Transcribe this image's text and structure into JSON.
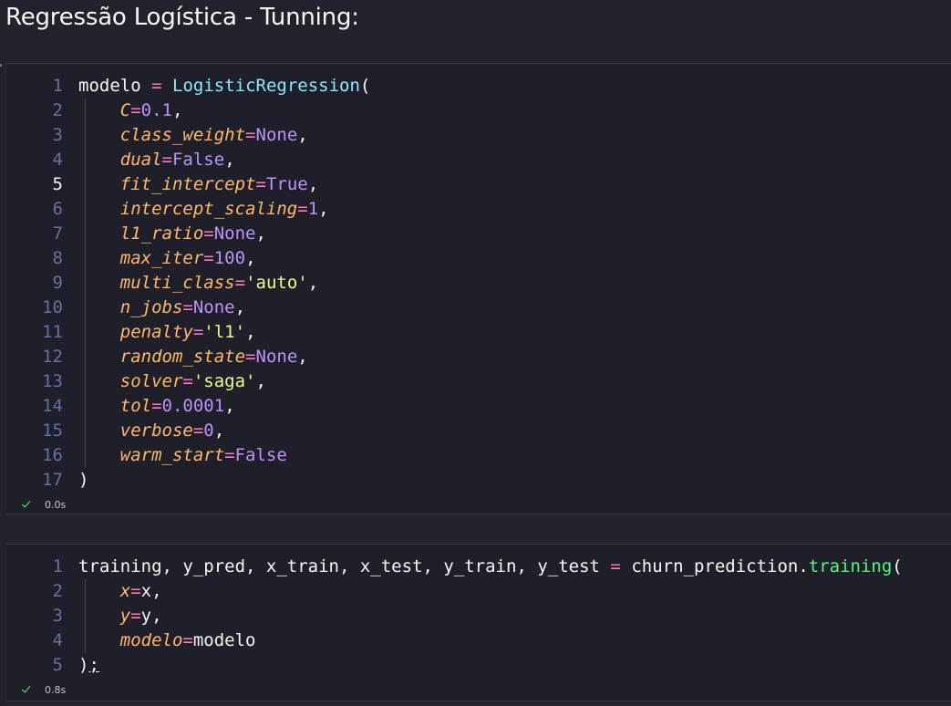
{
  "markdown": {
    "title": "Regressão Logística - Tunning:"
  },
  "cells": [
    {
      "status_time": "0.0s",
      "active_line": 5,
      "lines": [
        {
          "n": "1",
          "indent": false,
          "tokens": [
            {
              "t": "modelo",
              "c": "default"
            },
            {
              "t": " ",
              "c": "default"
            },
            {
              "t": "=",
              "c": "op"
            },
            {
              "t": " ",
              "c": "default"
            },
            {
              "t": "LogisticRegression",
              "c": "cls"
            },
            {
              "t": "(",
              "c": "punct"
            }
          ]
        },
        {
          "n": "2",
          "indent": true,
          "tokens": [
            {
              "t": "    ",
              "c": "default"
            },
            {
              "t": "C",
              "c": "param"
            },
            {
              "t": "=",
              "c": "op"
            },
            {
              "t": "0.1",
              "c": "num"
            },
            {
              "t": ",",
              "c": "punct"
            }
          ]
        },
        {
          "n": "3",
          "indent": true,
          "tokens": [
            {
              "t": "    ",
              "c": "default"
            },
            {
              "t": "class_weight",
              "c": "param"
            },
            {
              "t": "=",
              "c": "op"
            },
            {
              "t": "None",
              "c": "const"
            },
            {
              "t": ",",
              "c": "punct"
            }
          ]
        },
        {
          "n": "4",
          "indent": true,
          "tokens": [
            {
              "t": "    ",
              "c": "default"
            },
            {
              "t": "dual",
              "c": "param"
            },
            {
              "t": "=",
              "c": "op"
            },
            {
              "t": "False",
              "c": "const"
            },
            {
              "t": ",",
              "c": "punct"
            }
          ]
        },
        {
          "n": "5",
          "indent": true,
          "tokens": [
            {
              "t": "    ",
              "c": "default"
            },
            {
              "t": "fit_intercept",
              "c": "param"
            },
            {
              "t": "=",
              "c": "op"
            },
            {
              "t": "True",
              "c": "const"
            },
            {
              "t": ",",
              "c": "punct"
            }
          ]
        },
        {
          "n": "6",
          "indent": true,
          "tokens": [
            {
              "t": "    ",
              "c": "default"
            },
            {
              "t": "intercept_scaling",
              "c": "param"
            },
            {
              "t": "=",
              "c": "op"
            },
            {
              "t": "1",
              "c": "num"
            },
            {
              "t": ",",
              "c": "punct"
            }
          ]
        },
        {
          "n": "7",
          "indent": true,
          "tokens": [
            {
              "t": "    ",
              "c": "default"
            },
            {
              "t": "l1_ratio",
              "c": "param"
            },
            {
              "t": "=",
              "c": "op"
            },
            {
              "t": "None",
              "c": "const"
            },
            {
              "t": ",",
              "c": "punct"
            }
          ]
        },
        {
          "n": "8",
          "indent": true,
          "tokens": [
            {
              "t": "    ",
              "c": "default"
            },
            {
              "t": "max_iter",
              "c": "param"
            },
            {
              "t": "=",
              "c": "op"
            },
            {
              "t": "100",
              "c": "num"
            },
            {
              "t": ",",
              "c": "punct"
            }
          ]
        },
        {
          "n": "9",
          "indent": true,
          "tokens": [
            {
              "t": "    ",
              "c": "default"
            },
            {
              "t": "multi_class",
              "c": "param"
            },
            {
              "t": "=",
              "c": "op"
            },
            {
              "t": "'auto'",
              "c": "str"
            },
            {
              "t": ",",
              "c": "punct"
            }
          ]
        },
        {
          "n": "10",
          "indent": true,
          "tokens": [
            {
              "t": "    ",
              "c": "default"
            },
            {
              "t": "n_jobs",
              "c": "param"
            },
            {
              "t": "=",
              "c": "op"
            },
            {
              "t": "None",
              "c": "const"
            },
            {
              "t": ",",
              "c": "punct"
            }
          ]
        },
        {
          "n": "11",
          "indent": true,
          "tokens": [
            {
              "t": "    ",
              "c": "default"
            },
            {
              "t": "penalty",
              "c": "param"
            },
            {
              "t": "=",
              "c": "op"
            },
            {
              "t": "'l1'",
              "c": "str"
            },
            {
              "t": ",",
              "c": "punct"
            }
          ]
        },
        {
          "n": "12",
          "indent": true,
          "tokens": [
            {
              "t": "    ",
              "c": "default"
            },
            {
              "t": "random_state",
              "c": "param"
            },
            {
              "t": "=",
              "c": "op"
            },
            {
              "t": "None",
              "c": "const"
            },
            {
              "t": ",",
              "c": "punct"
            }
          ]
        },
        {
          "n": "13",
          "indent": true,
          "tokens": [
            {
              "t": "    ",
              "c": "default"
            },
            {
              "t": "solver",
              "c": "param"
            },
            {
              "t": "=",
              "c": "op"
            },
            {
              "t": "'saga'",
              "c": "str"
            },
            {
              "t": ",",
              "c": "punct"
            }
          ]
        },
        {
          "n": "14",
          "indent": true,
          "tokens": [
            {
              "t": "    ",
              "c": "default"
            },
            {
              "t": "tol",
              "c": "param"
            },
            {
              "t": "=",
              "c": "op"
            },
            {
              "t": "0.0001",
              "c": "num"
            },
            {
              "t": ",",
              "c": "punct"
            }
          ]
        },
        {
          "n": "15",
          "indent": true,
          "tokens": [
            {
              "t": "    ",
              "c": "default"
            },
            {
              "t": "verbose",
              "c": "param"
            },
            {
              "t": "=",
              "c": "op"
            },
            {
              "t": "0",
              "c": "num"
            },
            {
              "t": ",",
              "c": "punct"
            }
          ]
        },
        {
          "n": "16",
          "indent": true,
          "tokens": [
            {
              "t": "    ",
              "c": "default"
            },
            {
              "t": "warm_start",
              "c": "param"
            },
            {
              "t": "=",
              "c": "op"
            },
            {
              "t": "False",
              "c": "const"
            }
          ]
        },
        {
          "n": "17",
          "indent": false,
          "tokens": [
            {
              "t": ")",
              "c": "punct"
            }
          ]
        }
      ]
    },
    {
      "status_time": "0.8s",
      "active_line": 0,
      "lines": [
        {
          "n": "1",
          "indent": false,
          "tokens": [
            {
              "t": "training, y_pred, x_train, x_test, y_train, y_test",
              "c": "default"
            },
            {
              "t": " ",
              "c": "default"
            },
            {
              "t": "=",
              "c": "op"
            },
            {
              "t": " ",
              "c": "default"
            },
            {
              "t": "churn_prediction.",
              "c": "default"
            },
            {
              "t": "training",
              "c": "fn"
            },
            {
              "t": "(",
              "c": "punct"
            }
          ]
        },
        {
          "n": "2",
          "indent": true,
          "tokens": [
            {
              "t": "    ",
              "c": "default"
            },
            {
              "t": "x",
              "c": "param"
            },
            {
              "t": "=",
              "c": "op"
            },
            {
              "t": "x",
              "c": "default"
            },
            {
              "t": ",",
              "c": "punct"
            }
          ]
        },
        {
          "n": "3",
          "indent": true,
          "tokens": [
            {
              "t": "    ",
              "c": "default"
            },
            {
              "t": "y",
              "c": "param"
            },
            {
              "t": "=",
              "c": "op"
            },
            {
              "t": "y",
              "c": "default"
            },
            {
              "t": ",",
              "c": "punct"
            }
          ]
        },
        {
          "n": "4",
          "indent": true,
          "tokens": [
            {
              "t": "    ",
              "c": "default"
            },
            {
              "t": "modelo",
              "c": "param"
            },
            {
              "t": "=",
              "c": "op"
            },
            {
              "t": "modelo",
              "c": "default"
            }
          ]
        },
        {
          "n": "5",
          "indent": false,
          "tokens": [
            {
              "t": ")",
              "c": "punct"
            },
            {
              "t": ";",
              "c": "under"
            }
          ]
        }
      ]
    }
  ]
}
